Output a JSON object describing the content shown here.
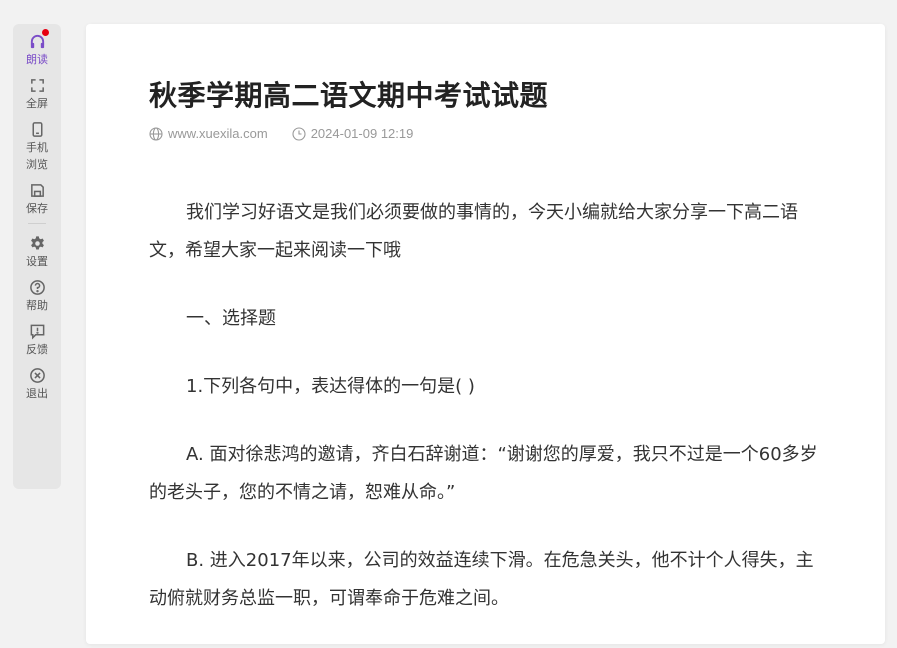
{
  "sidebar": {
    "items": [
      {
        "label": "朗读",
        "icon": "headphones-icon",
        "active": true,
        "badge": true
      },
      {
        "label": "全屏",
        "icon": "fullscreen-icon"
      },
      {
        "label": "手机浏览",
        "icon": "mobile-icon"
      },
      {
        "label": "保存",
        "icon": "save-icon"
      },
      {
        "label": "设置",
        "icon": "gear-icon"
      },
      {
        "label": "帮助",
        "icon": "help-icon"
      },
      {
        "label": "反馈",
        "icon": "feedback-icon"
      },
      {
        "label": "退出",
        "icon": "exit-icon"
      }
    ],
    "active_color": "#7b4dc8",
    "badge_color": "#e60012"
  },
  "article": {
    "title": "秋季学期高二语文期中考试试题",
    "source": "www.xuexila.com",
    "datetime": "2024-01-09 12:19",
    "paragraphs": [
      "我们学习好语文是我们必须要做的事情的，今天小编就给大家分享一下高二语文，希望大家一起来阅读一下哦",
      "一、选择题",
      "1.下列各句中，表达得体的一句是( )",
      "A. 面对徐悲鸿的邀请，齐白石辞谢道：“谢谢您的厚爱，我只不过是一个60多岁的老头子，您的不情之请，恕难从命。”",
      "B. 进入2017年以来，公司的效益连续下滑。在危急关头，他不计个人得失，主动俯就财务总监一职，可谓奉命于危难之间。"
    ]
  }
}
